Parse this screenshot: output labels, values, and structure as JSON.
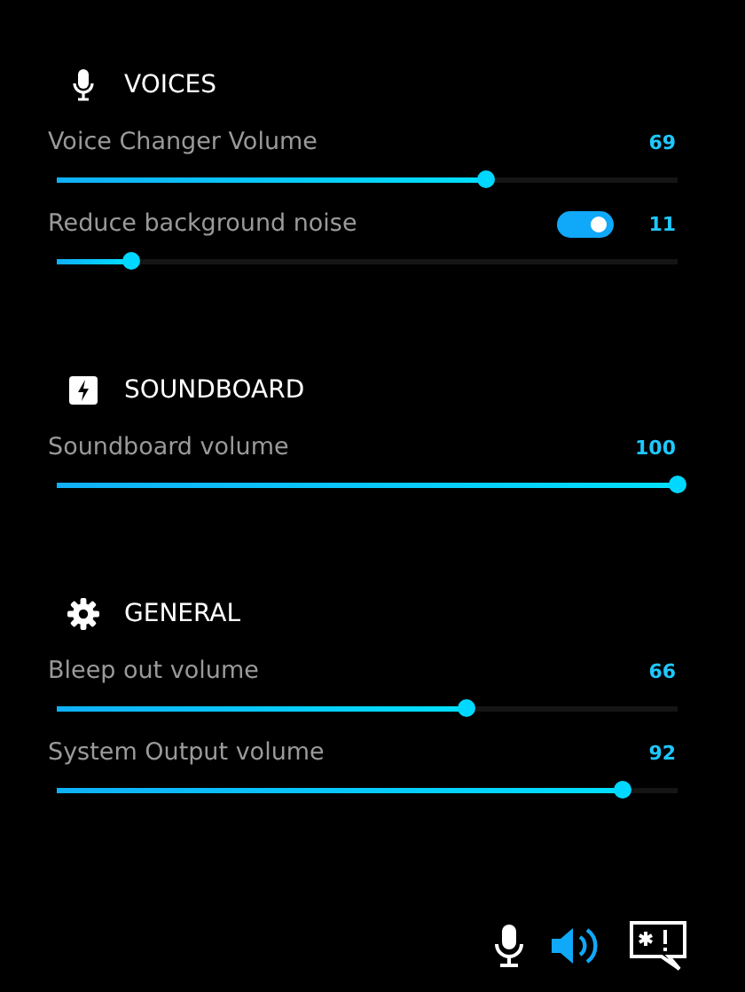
{
  "sections": [
    {
      "title": "VOICES",
      "controls": [
        {
          "label": "Voice Changer Volume",
          "value": "69",
          "level": 0.69
        },
        {
          "label": "Reduce background noise",
          "value": "11",
          "level": 0.12,
          "toggle": {
            "on": true
          }
        }
      ]
    },
    {
      "title": "SOUNDBOARD",
      "controls": [
        {
          "label": "Soundboard volume",
          "value": "100",
          "level": 1.0
        }
      ]
    },
    {
      "title": "GENERAL",
      "controls": [
        {
          "label": "Bleep out volume",
          "value": "66",
          "level": 0.66
        },
        {
          "label": "System Output volume",
          "value": "92",
          "level": 0.91
        }
      ]
    }
  ],
  "toolbar": [
    {
      "selected": false
    },
    {
      "selected": true
    },
    {
      "selected": false
    }
  ]
}
